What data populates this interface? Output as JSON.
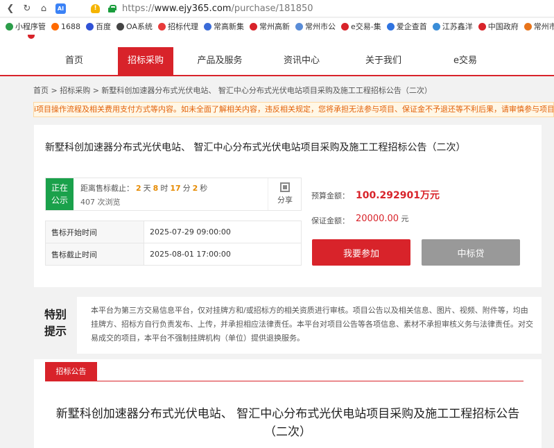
{
  "browser": {
    "url_prefix": "https://",
    "url_host": "www.ejy365.com",
    "url_path": "/purchase/181850",
    "ai_label": "AI",
    "bookmarks": [
      {
        "label": "小程序管",
        "color": "#2c9d4a"
      },
      {
        "label": "1688",
        "color": "#ff6a00"
      },
      {
        "label": "百度",
        "color": "#3052d6"
      },
      {
        "label": "OA系统",
        "color": "#444444"
      },
      {
        "label": "招标代理",
        "color": "#e83a3a"
      },
      {
        "label": "常高新集",
        "color": "#3a6bd8"
      },
      {
        "label": "常州高新",
        "color": "#d8232a"
      },
      {
        "label": "常州市公",
        "color": "#5a8dd8"
      },
      {
        "label": "e交易-集",
        "color": "#d8232a"
      },
      {
        "label": "爱企查首",
        "color": "#2f73e0"
      },
      {
        "label": "江苏鑫洋",
        "color": "#3a8dd8"
      },
      {
        "label": "中国政府",
        "color": "#d8232a"
      },
      {
        "label": "常州市公",
        "color": "#e8741a"
      }
    ]
  },
  "nav": {
    "items": [
      "首页",
      "招标采购",
      "产品及服务",
      "资讯中心",
      "关于我们",
      "e交易"
    ]
  },
  "breadcrumb": "首页 > 招标采购 > 新墅科创加速器分布式光伏电站、 智汇中心分布式光伏电站项目采购及施工工程招标公告（二次）",
  "notice": "i项目操作流程及相关费用支付方式等内容。如未全面了解相关内容，违反相关规定，您将承担无法参与项目、保证金不予退还等不利后果，请审慎参与项目",
  "project": {
    "title": "新墅科创加速器分布式光伏电站、 智汇中心分布式光伏电站项目采购及施工工程招标公告（二次）",
    "status_line1": "正在",
    "status_line2": "公示",
    "countdown_label": "距离售标截止：",
    "days": "2",
    "days_unit": "天",
    "hours": "8",
    "hours_unit": "时",
    "minutes": "17",
    "minutes_unit": "分",
    "seconds": "2",
    "seconds_unit": "秒",
    "views": "407 次浏览",
    "share_label": "分享",
    "sale_start_label": "售标开始时间",
    "sale_start_value": "2025-07-29 09:00:00",
    "sale_end_label": "售标截止时间",
    "sale_end_value": "2025-08-01 17:00:00",
    "budget_label": "预算金额：",
    "budget_value": "100.292901万元",
    "deposit_label": "保证金额：",
    "deposit_value": "20000.00",
    "deposit_unit": " 元",
    "join_button": "我要参加",
    "loan_button": "中标贷"
  },
  "special": {
    "head_line1": "特别",
    "head_line2": "提示",
    "text": "本平台为第三方交易信息平台，仅对挂牌方和/或招标方的相关资质进行审核。项目公告以及相关信息、图片、视频、附件等，均由挂牌方、招标方自行负责发布、上传，并承担相应法律责任。本平台对项目公告等各项信息、素材不承担审核义务与法律责任。对交易成交的项目，本平台不强制挂牌机构（单位）提供退换服务。"
  },
  "announcement": {
    "tab_label": "招标公告",
    "title": "新墅科创加速器分布式光伏电站、 智汇中心分布式光伏电站项目采购及施工工程招标公告（二次）"
  }
}
